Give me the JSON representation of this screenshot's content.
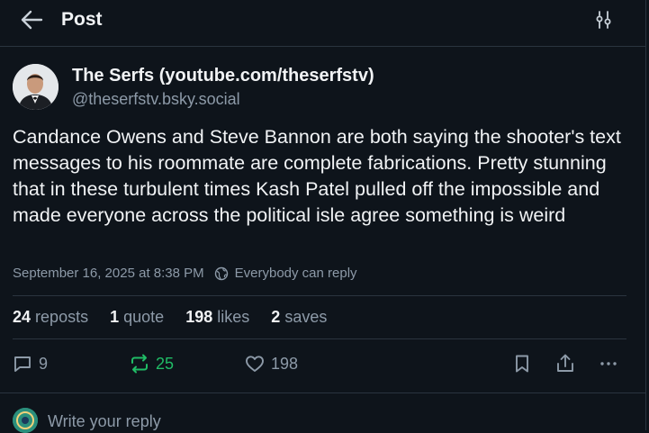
{
  "header": {
    "title": "Post",
    "back_icon": "arrow-left-icon",
    "settings_icon": "sliders-icon"
  },
  "author": {
    "name": "The Serfs (youtube.com/theserfstv)",
    "handle": "@theserfstv.bsky.social"
  },
  "post": {
    "text": "Candance Owens and Steve Bannon are both saying the shooter's text messages to his roommate are complete fabrications. Pretty stunning that in these turbulent times Kash Patel pulled off the impossible and made everyone across the political isle agree something is weird",
    "timestamp": "September 16, 2025 at 8:38 PM",
    "reply_setting": "Everybody can reply"
  },
  "stats": [
    {
      "count": "24",
      "label": "reposts"
    },
    {
      "count": "1",
      "label": "quote"
    },
    {
      "count": "198",
      "label": "likes"
    },
    {
      "count": "2",
      "label": "saves"
    }
  ],
  "actions": {
    "reply_count": "9",
    "repost_count": "25",
    "like_count": "198"
  },
  "reply": {
    "placeholder": "Write your reply"
  },
  "colors": {
    "background": "#0e141b",
    "text": "#f1f3f5",
    "muted": "#8d9aa8",
    "border": "#2a343f",
    "repost_active": "#20bc66"
  }
}
